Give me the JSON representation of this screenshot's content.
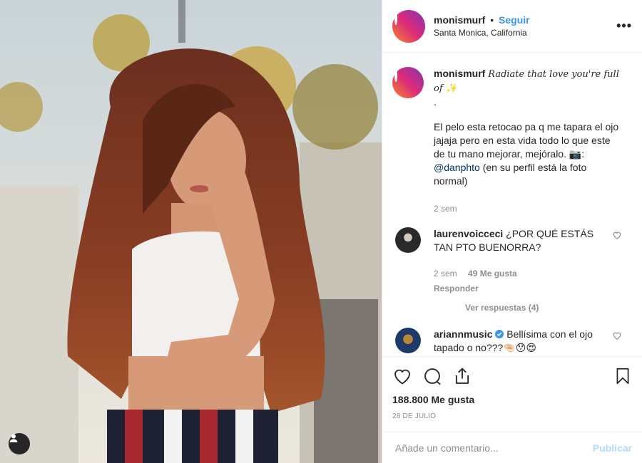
{
  "post": {
    "username": "monismurf",
    "follow_label": "Seguir",
    "location": "Santa Monica, California",
    "more_label": "•••"
  },
  "caption": {
    "username": "monismurf",
    "fancy_text": "Radiate that love you're full of ✨",
    "line_dot": ".",
    "text_before_mention": "El pelo esta retocao pa q me tapara el ojo jajaja pero en esta vida todo lo que este de tu mano mejorar, mejóralo. 📷: ",
    "mention": "@danphto",
    "text_after_mention": " (en su perfil está la foto normal)",
    "time": "2 sem"
  },
  "comments": [
    {
      "username": "laurenvoicceci",
      "text": "¿POR QUÉ ESTÁS TAN PTO BUENORRA?",
      "time": "2 sem",
      "likes": "49 Me gusta",
      "reply_label": "Responder",
      "view_replies": "Ver respuestas (4)"
    },
    {
      "username": "ariannmusic",
      "verified": true,
      "text": "Bellísima con el ojo tapado o no???🤏🏻😯😍"
    }
  ],
  "engagement": {
    "likes": "188.800 Me gusta",
    "date": "28 DE JULIO"
  },
  "composer": {
    "placeholder": "Añade un comentario...",
    "publish_label": "Publicar"
  },
  "colors": {
    "accent": "#3897f0",
    "muted": "#8e8e8e",
    "publish_disabled": "#b3dbff",
    "story_ring": "#dd2a7b"
  }
}
